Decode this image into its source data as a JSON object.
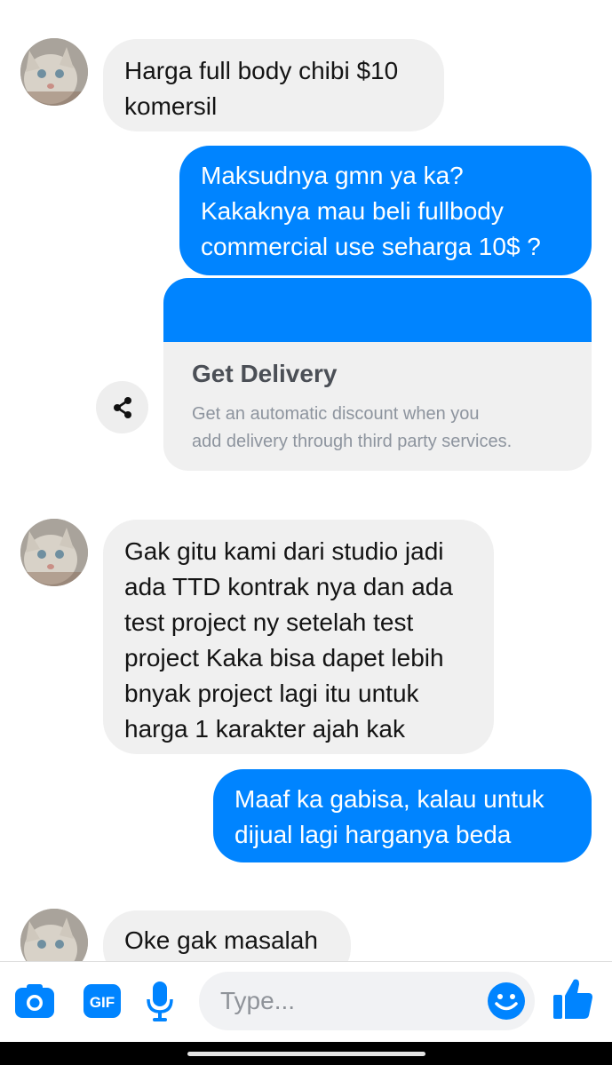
{
  "messages": [
    {
      "from": "them",
      "text": "Harga full body chibi $10\nkomersil"
    },
    {
      "from": "me",
      "text": "Maksudnya gmn ya ka?\nKakaknya mau beli fullbody\ncommercial use seharga 10$ ?"
    },
    {
      "from": "them",
      "text": "Gak gitu kami dari studio jadi\nada TTD kontrak nya dan ada\ntest project ny setelah test\nproject Kaka bisa dapet lebih\nbnyak project lagi itu untuk\nharga 1 karakter ajah kak"
    },
    {
      "from": "me",
      "text": "Maaf ka gabisa, kalau untuk\ndijual lagi harganya beda"
    },
    {
      "from": "them",
      "text": "Oke gak masalah"
    }
  ],
  "link_card": {
    "title": "Get Delivery",
    "description": "Get an automatic discount when you\nadd delivery through third party services.",
    "accent_color": "#0084ff"
  },
  "composer": {
    "placeholder": "Type...",
    "gif_label": "GIF",
    "icons": [
      "camera-icon",
      "gif-icon",
      "microphone-icon",
      "emoji-icon",
      "like-icon"
    ]
  },
  "colors": {
    "outgoing_bubble": "#0084ff",
    "incoming_bubble": "#f0f0f0",
    "icon_blue": "#0084ff"
  }
}
